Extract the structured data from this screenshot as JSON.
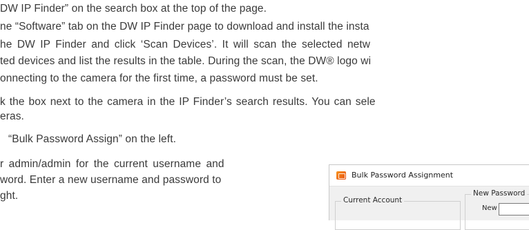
{
  "lines": [
    "DW IP Finder” on the search box at the top of the page.",
    "ne “Software” tab on the DW IP Finder page to download and install the insta",
    "he DW IP Finder and click ‘Scan Devices’. It will scan the selected netw",
    "ted devices and list the results in the table. During the scan, the DW® logo wi",
    "onnecting to the camera for the first time, a password must be set.",
    "k the box next to the camera in the IP Finder’s search results. You can sele",
    "eras.",
    " “Bulk Password Assign” on the left.",
    "r admin/admin for the current username and",
    "word. Enter a new username and password to",
    "ght."
  ],
  "screenshot": {
    "title": "Bulk Password Assignment",
    "icon": "dw-app-icon",
    "current_account_label": "Current Account",
    "new_password_label": "New Password",
    "new_field_label": "New"
  }
}
